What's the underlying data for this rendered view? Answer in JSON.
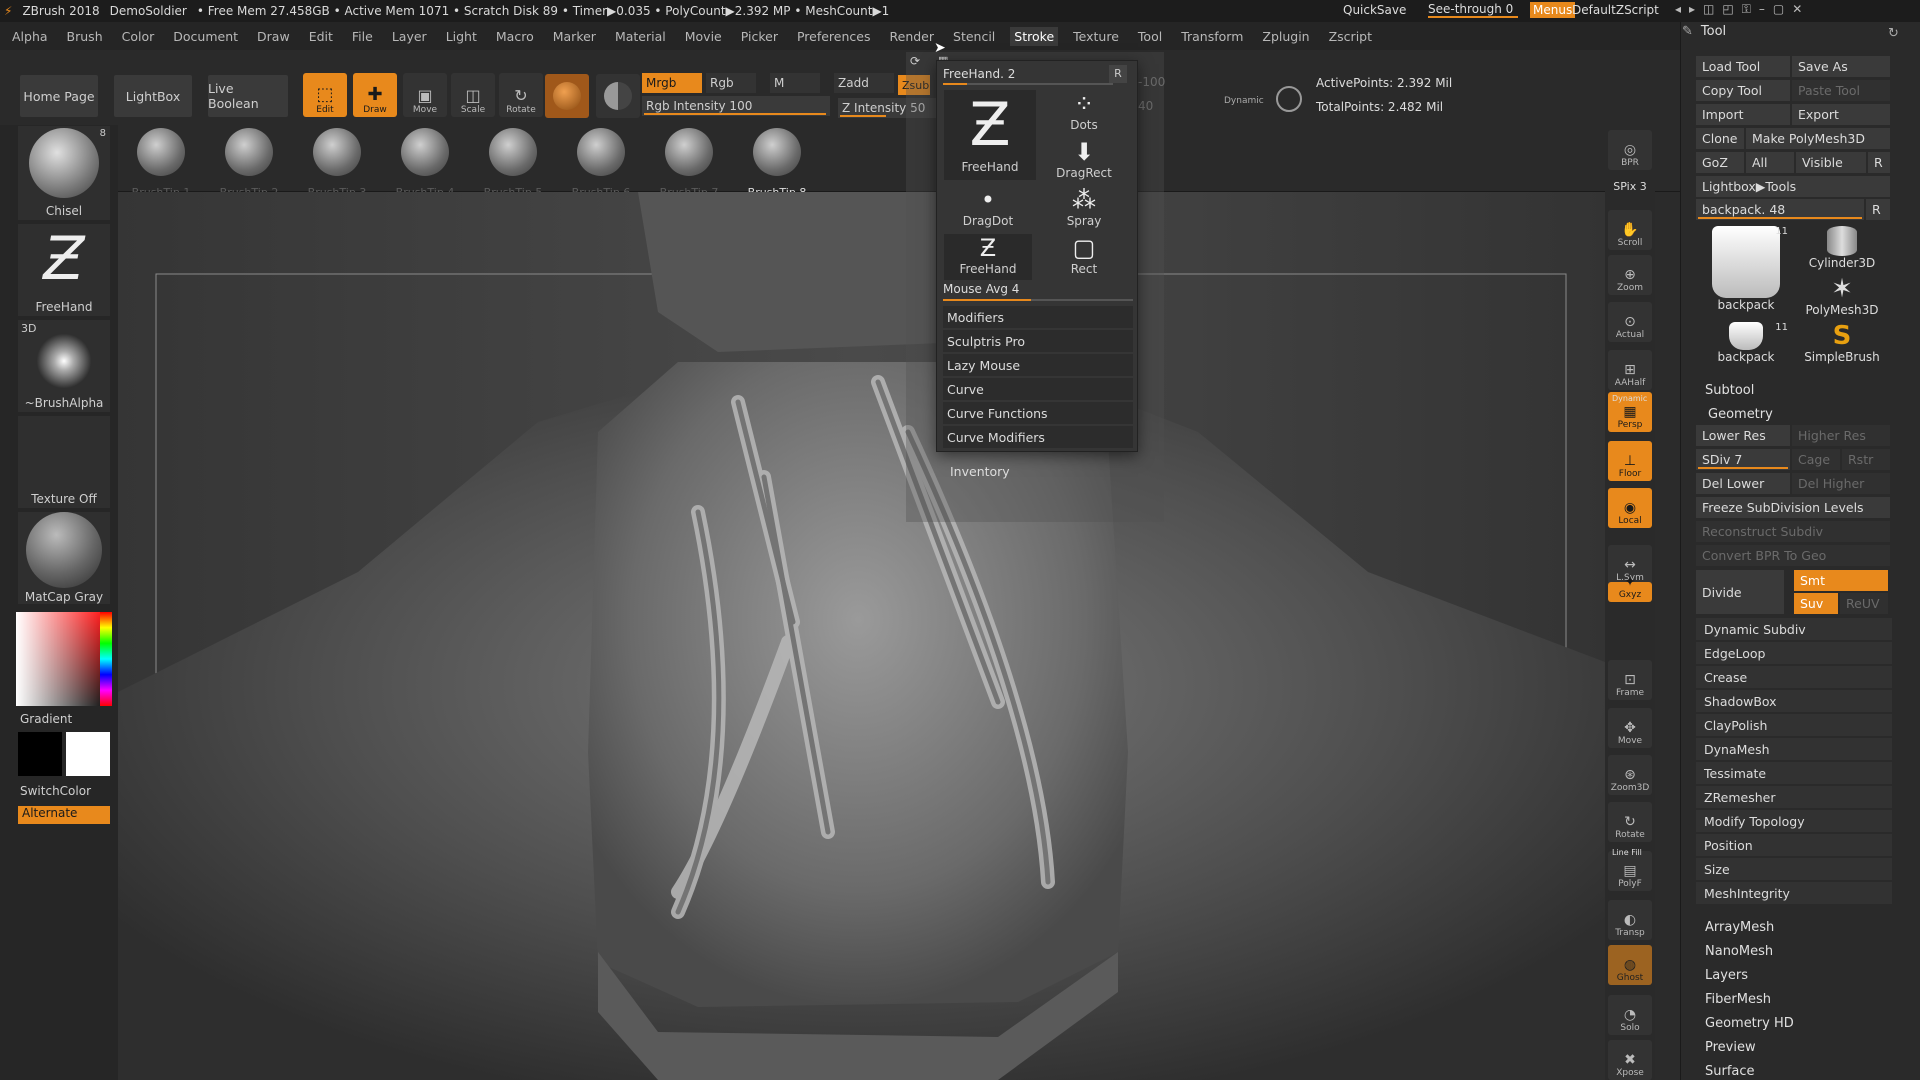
{
  "titlebar": {
    "app": "ZBrush 2018",
    "project": "DemoSoldier",
    "status": "• Free Mem 27.458GB • Active Mem 1071 • Scratch Disk 89 • Timer▶0.035 • PolyCount▶2.392 MP • MeshCount▶1",
    "quicksave": "QuickSave",
    "seethrough": "See-through   0",
    "menus": "Menus",
    "default_zscript": "DefaultZScript"
  },
  "menubar": [
    "Alpha",
    "Brush",
    "Color",
    "Document",
    "Draw",
    "Edit",
    "File",
    "Layer",
    "Light",
    "Macro",
    "Marker",
    "Material",
    "Movie",
    "Picker",
    "Preferences",
    "Render",
    "Stencil",
    "Stroke",
    "Texture",
    "Tool",
    "Transform",
    "Zplugin",
    "Zscript"
  ],
  "active_menu": "Stroke",
  "toolbar": {
    "home_page": "Home Page",
    "lightbox": "LightBox",
    "live_boolean": "Live Boolean",
    "edit": "Edit",
    "draw": "Draw",
    "move": "Move",
    "scale": "Scale",
    "rotate": "Rotate",
    "mrgb": "Mrgb",
    "rgb": "Rgb",
    "m": "M",
    "zadd": "Zadd",
    "zsub": "Zsub",
    "rgb_intensity": "Rgb Intensity 100",
    "z_intensity": "Z Intensity 50",
    "focal_value": "-100",
    "draw_value": "40",
    "dynamic": "Dynamic",
    "active_points": "ActivePoints: 2.392 Mil",
    "total_points": "TotalPoints: 2.482 Mil"
  },
  "brush_tips": [
    "BrushTip 1",
    "BrushTip 2",
    "BrushTip 3",
    "BrushTip 4",
    "BrushTip 5",
    "BrushTip 6",
    "BrushTip 7",
    "BrushTip 8"
  ],
  "left_panel": {
    "chisel": "Chisel",
    "chisel_badge": "8",
    "freehand": "FreeHand",
    "alpha_tag": "3D",
    "brush_alpha": "~BrushAlpha",
    "texture": "Texture Off",
    "matcap": "MatCap Gray",
    "gradient": "Gradient",
    "switch_color": "SwitchColor",
    "alternate": "Alternate"
  },
  "stroke_popup": {
    "header": "FreeHand. 2",
    "r_button": "R",
    "tiles": [
      "FreeHand",
      "Dots",
      "DragRect",
      "DragDot",
      "Spray",
      "FreeHand",
      "Rect"
    ],
    "mouse_avg": "Mouse Avg 4",
    "items": [
      "Modifiers",
      "Sculptris Pro",
      "Lazy Mouse",
      "Curve",
      "Curve Functions",
      "Curve Modifiers"
    ],
    "inventory": "Inventory"
  },
  "right_strip": [
    "BPR",
    "SPix 3",
    "Scroll",
    "Zoom",
    "Actual",
    "AAHalf",
    "Persp",
    "Floor",
    "Local",
    "L.Sym",
    "Gxyz",
    "Frame",
    "Move",
    "Zoom3D",
    "Rotate",
    "PolyF",
    "Transp",
    "Ghost",
    "Solo",
    "Xpose"
  ],
  "right_strip_small": {
    "dynamic": "Dynamic",
    "line_fill": "Line Fill"
  },
  "tool_panel": {
    "title": "Tool",
    "load_tool": "Load Tool",
    "save_as": "Save As",
    "copy_tool": "Copy Tool",
    "paste_tool": "Paste Tool",
    "import": "Import",
    "export": "Export",
    "clone": "Clone",
    "make_polymesh": "Make PolyMesh3D",
    "goz": "GoZ",
    "all": "All",
    "visible": "Visible",
    "r": "R",
    "lightbox_tools": "Lightbox▶Tools",
    "current_tool": "backpack. 48",
    "thumbs": [
      "backpack",
      "Cylinder3D",
      "PolyMesh3D",
      "backpack",
      "SimpleBrush"
    ],
    "thumb_count": "11",
    "subtool": "Subtool",
    "geometry": "Geometry",
    "lower_res": "Lower Res",
    "higher_res": "Higher Res",
    "sdiv": "SDiv 7",
    "cage": "Cage",
    "rstr": "Rstr",
    "del_lower": "Del Lower",
    "del_higher": "Del Higher",
    "freeze_subdiv": "Freeze SubDivision Levels",
    "reconstruct_subdiv": "Reconstruct Subdiv",
    "convert_bpr": "Convert BPR To Geo",
    "divide": "Divide",
    "smt": "Smt",
    "suv": "Suv",
    "reuv": "ReUV",
    "geometry_items": [
      "Dynamic Subdiv",
      "EdgeLoop",
      "Crease",
      "ShadowBox",
      "ClayPolish",
      "DynaMesh",
      "Tessimate",
      "ZRemesher",
      "Modify Topology",
      "Position",
      "Size",
      "MeshIntegrity"
    ],
    "sections": [
      "ArrayMesh",
      "NanoMesh",
      "Layers",
      "FiberMesh",
      "Geometry HD",
      "Preview",
      "Surface"
    ]
  },
  "colors": {
    "accent": "#e8891c",
    "background": "#2a2a2a"
  }
}
